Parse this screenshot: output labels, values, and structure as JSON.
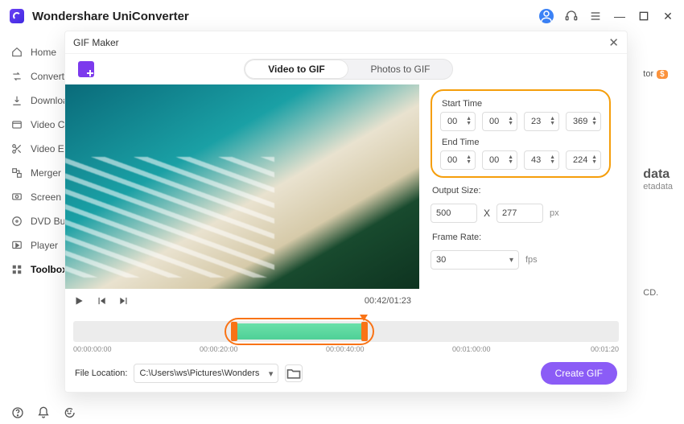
{
  "app": {
    "title": "Wondershare UniConverter"
  },
  "sidebar": {
    "items": [
      {
        "label": "Home"
      },
      {
        "label": "Convert"
      },
      {
        "label": "Downloa"
      },
      {
        "label": "Video Co"
      },
      {
        "label": "Video Ed"
      },
      {
        "label": "Merger"
      },
      {
        "label": "Screen R"
      },
      {
        "label": "DVD Bu"
      },
      {
        "label": "Player"
      },
      {
        "label": "Toolbox"
      }
    ]
  },
  "bg": {
    "tor": "tor",
    "data": "data",
    "meta": "etadata",
    "cd": "CD."
  },
  "modal": {
    "title": "GIF Maker",
    "tabs": {
      "video": "Video to GIF",
      "photos": "Photos to GIF"
    },
    "time": {
      "start_label": "Start Time",
      "start": {
        "h": "00",
        "m": "00",
        "s": "23",
        "ms": "369"
      },
      "end_label": "End Time",
      "end": {
        "h": "00",
        "m": "00",
        "s": "43",
        "ms": "224"
      }
    },
    "output": {
      "label": "Output Size:",
      "w": "500",
      "x": "X",
      "h": "277",
      "unit": "px"
    },
    "rate": {
      "label": "Frame Rate:",
      "value": "30",
      "unit": "fps"
    },
    "player": {
      "timecode": "00:42/01:23"
    },
    "timeline": {
      "ticks": [
        "00:00:00:00",
        "00:00:20:00",
        "00:00:40:00",
        "00:01:00:00",
        "00:01:20"
      ]
    },
    "footer": {
      "loc_label": "File Location:",
      "loc_value": "C:\\Users\\ws\\Pictures\\Wonders",
      "create": "Create GIF"
    }
  }
}
